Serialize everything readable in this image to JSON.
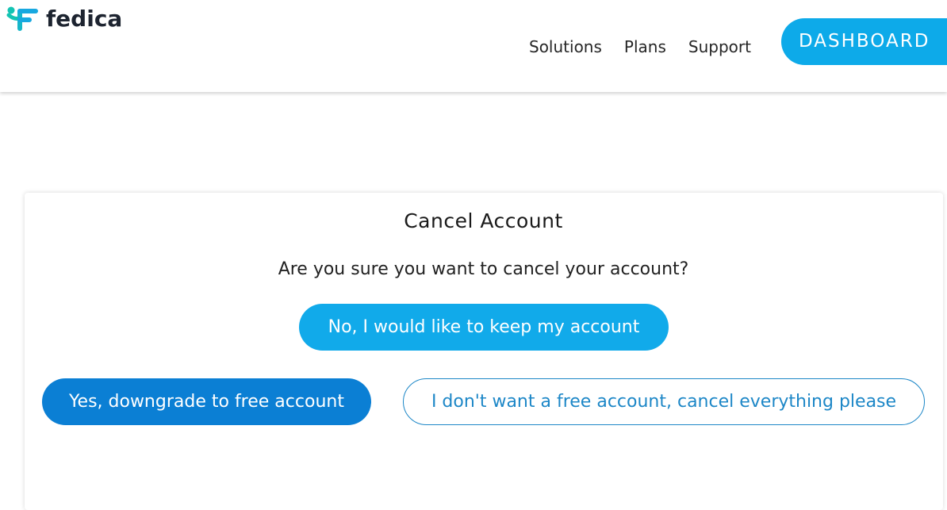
{
  "brand": {
    "name": "fedica",
    "logo_colors": [
      "#13c4b3",
      "#18a8e0"
    ]
  },
  "nav": {
    "items": [
      "Solutions",
      "Plans",
      "Support"
    ],
    "dashboard_label": "DASHBOARD"
  },
  "dialog": {
    "title": "Cancel Account",
    "question": "Are you sure you want to cancel your account?",
    "keep_label": "No, I would like to keep my account",
    "downgrade_label": "Yes, downgrade to free account",
    "cancel_all_label": "I don't want a free account, cancel everything please"
  },
  "colors": {
    "primary": "#11aaea",
    "primary_dark": "#0b7fd4",
    "outline": "#1d87c7"
  }
}
